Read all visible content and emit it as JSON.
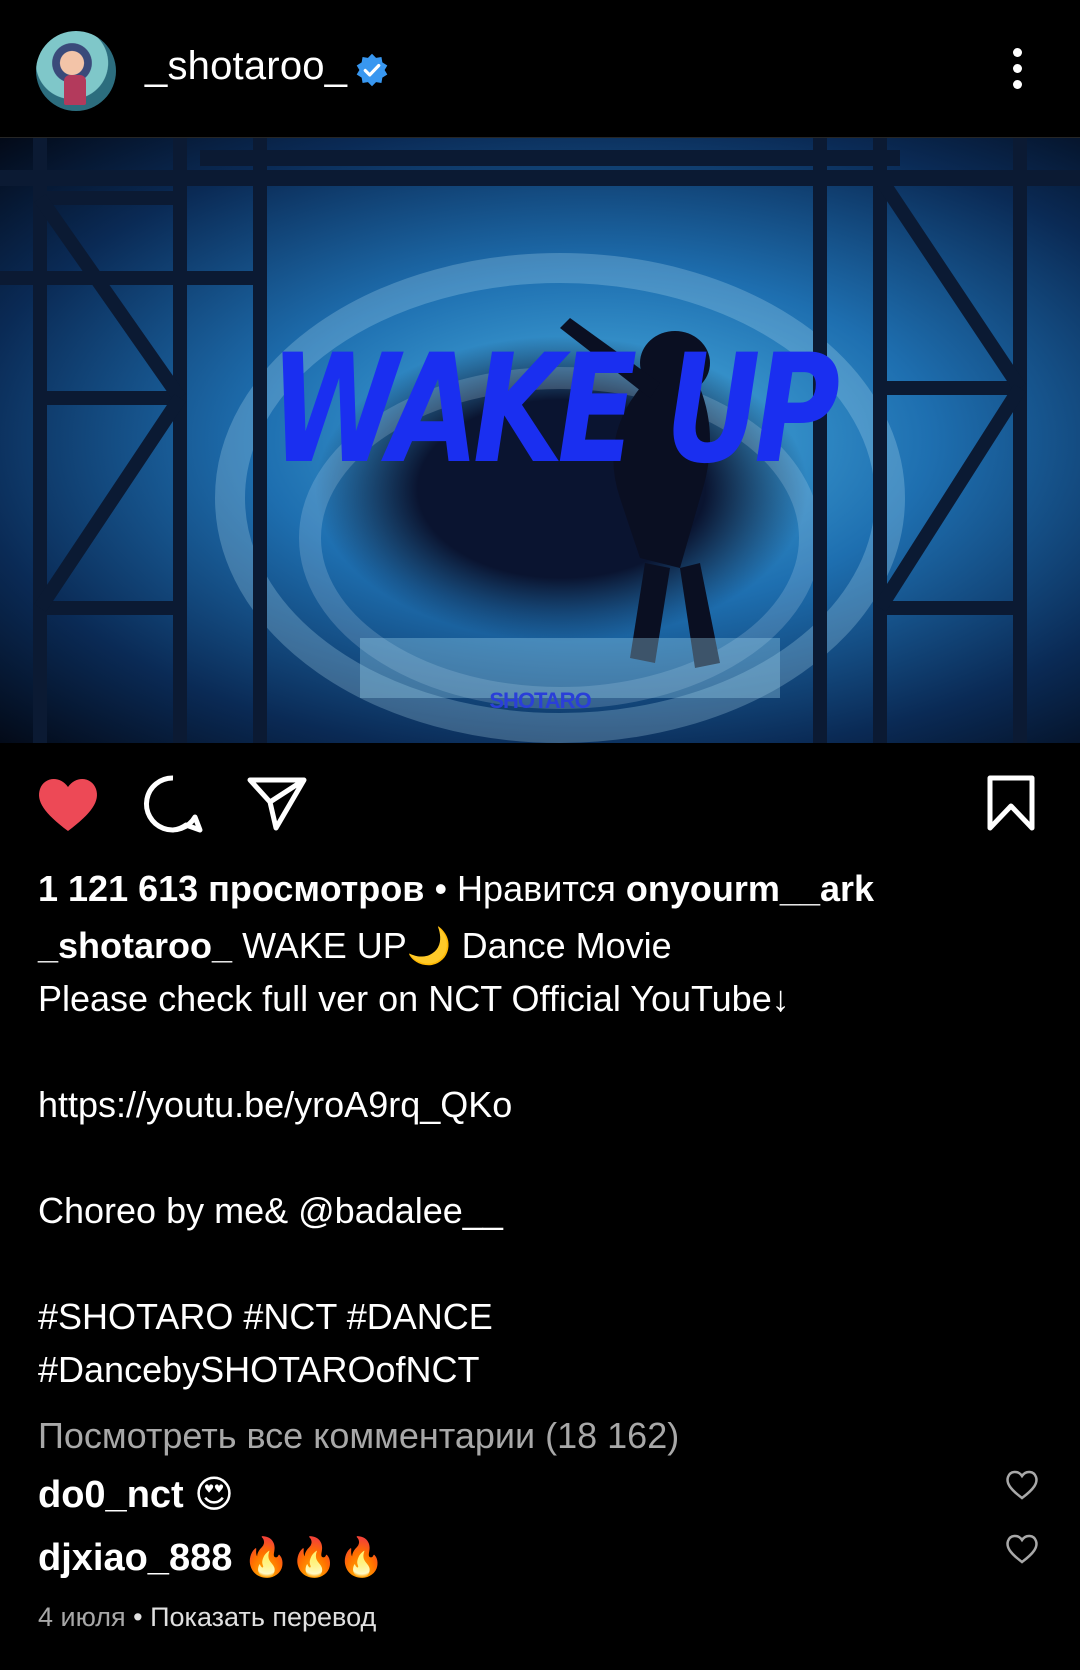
{
  "post": {
    "username": "_shotaroo_",
    "verified": true,
    "media": {
      "title_overlay": "WAKE UP",
      "signature": "SHOTARO"
    },
    "views_count": "1 121 613 просмотров",
    "likes_prefix": "• Нравится",
    "liked_by": "onyourm__ark",
    "caption": {
      "author": "_shotaroo_",
      "line1": "WAKE UP🌙 Dance Movie",
      "line2": "Please check full ver on NCT Official YouTube↓",
      "link": "https://youtu.be/yroA9rq_QKo",
      "choreo": "Choreo by me& @badalee__",
      "tags1": "#SHOTARO #NCT #DANCE",
      "tags2": "#DancebySHOTAROofNCT"
    },
    "view_all_comments": "Посмотреть все комментарии (18 162)",
    "comments": [
      {
        "user": "do0_nct",
        "text": "😍"
      },
      {
        "user": "djxiao_888",
        "text": "🔥🔥🔥"
      }
    ],
    "date": "4 июля",
    "translate": "• Показать перевод",
    "colors": {
      "like": "#ed4956",
      "verified": "#3897f0",
      "muted": "#a8a8a8"
    },
    "icons": [
      "heart-icon",
      "comment-icon",
      "share-icon",
      "bookmark-icon",
      "more-icon",
      "verified-icon"
    ]
  }
}
